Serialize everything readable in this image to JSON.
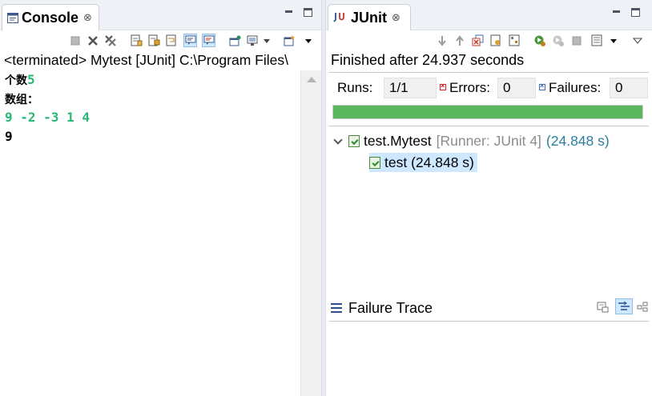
{
  "console": {
    "tab_title": "Console",
    "close_glyph": "⊗",
    "header": "<terminated> Mytest [JUnit] C:\\Program Files\\",
    "lines": [
      {
        "prefix": "个数",
        "value": "5"
      },
      {
        "prefix": "数组：",
        "value": ""
      },
      {
        "prefix": "",
        "value": "9 -2 -3 1 4"
      },
      {
        "prefix": "",
        "value": "9"
      }
    ],
    "toolbar_icons": [
      "terminate-icon",
      "remove-launch-icon",
      "remove-all-terminated-icon",
      "clear-console-icon",
      "scroll-lock-icon",
      "word-wrap-icon",
      "show-on-stdout-icon",
      "show-on-stderr-icon",
      "pin-console-icon",
      "display-selected-console-icon",
      "open-console-icon"
    ]
  },
  "junit": {
    "tab_title": "JUnit",
    "close_glyph": "⊗",
    "finished": "Finished after 24.937 seconds",
    "runs_label": "Runs:",
    "runs_value": "1/1",
    "errors_label": "Errors:",
    "errors_value": "0",
    "failures_label": "Failures:",
    "failures_value": "0",
    "progress": 1.0,
    "progress_color": "#5ab65d",
    "tree": {
      "suite_name": "test.Mytest",
      "suite_runner": "[Runner: JUnit 4]",
      "suite_time": "(24.848 s)",
      "test_label": "test (24.848 s)"
    },
    "failure_trace_title": "Failure Trace"
  },
  "colors": {
    "console_green": "#2bb673",
    "selection": "#cde8ff",
    "runner_gray": "#8c8c8c",
    "time_teal": "#2a7fa0"
  }
}
